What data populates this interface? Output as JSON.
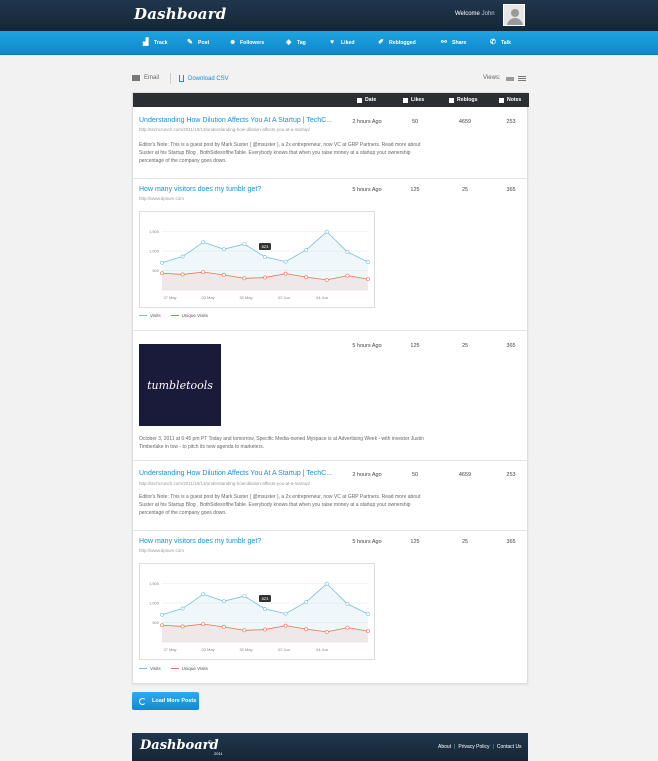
{
  "header": {
    "logo": "Dashboard",
    "welcome_prefix": "Welcome",
    "user_name": "John"
  },
  "nav": [
    {
      "label": "Track",
      "icon": "chart-icon"
    },
    {
      "label": "Post",
      "icon": "pen-icon"
    },
    {
      "label": "Followers",
      "icon": "people-icon"
    },
    {
      "label": "Tag",
      "icon": "tag-icon"
    },
    {
      "label": "Liked",
      "icon": "heart-icon"
    },
    {
      "label": "Reblogged",
      "icon": "pencil-icon"
    },
    {
      "label": "Share",
      "icon": "share-icon"
    },
    {
      "label": "Talk",
      "icon": "talk-icon"
    }
  ],
  "toolbar": {
    "email": "Email",
    "download": "Download CSV",
    "views": "Views:"
  },
  "table": {
    "columns": [
      "Date",
      "Likes",
      "Reblogs",
      "Notes"
    ]
  },
  "posts": [
    {
      "title": "Understanding How Dilution Affects You At A Startup | TechC...",
      "url": "http://techcrunch.com/2011/10/13/understanding-how-dilution-affects-you-at-a-startup/",
      "excerpt": "Editor's Note: This is a guest post by Mark Suster ( @msuster ), a 2x entrepreneur, now VC at GRP Partners. Read more about Suster at his Startup Blog , BothSidesoftheTable. Everybody knows that when you raise money at a startup your ownership percentage of the company goes down.",
      "date": "2 hours Ago",
      "likes": "50",
      "reblogs": "4659",
      "notes": "253"
    },
    {
      "title": "How many visitors does my tumblr get?",
      "url": "http://www.tipsum.com",
      "date": "5 hours Ago",
      "likes": "125",
      "reblogs": "25",
      "notes": "365",
      "legend": [
        "Visits",
        "Unique Visits"
      ]
    },
    {
      "image_text": "tumbletools",
      "excerpt": "October 3, 2011 at 6:45 pm PT Today and tomorrow, Specific Media-owned Myspace is at Advertising Week - with investor Justin Timberlake in tow - to pitch its new agenda to marketers.",
      "date": "5 hours Ago",
      "likes": "125",
      "reblogs": "25",
      "notes": "365"
    },
    {
      "title": "Understanding How Dilution Affects You At A Startup | TechC...",
      "url": "http://techcrunch.com/2011/10/13/understanding-how-dilution-affects-you-at-a-startup/",
      "excerpt": "Editor's Note: This is a guest post by Mark Suster ( @msuster ), a 2x entrepreneur, now VC at GRP Partners. Read more about Suster at his Startup Blog , BothSidesoftheTable. Everybody knows that when you raise money at a startup your ownership percentage of the company goes down.",
      "date": "2 hours Ago",
      "likes": "50",
      "reblogs": "4659",
      "notes": "253"
    },
    {
      "title": "How many visitors does my tumblr get?",
      "url": "http://www.tipsum.com",
      "date": "5 hours Ago",
      "likes": "125",
      "reblogs": "25",
      "notes": "365",
      "legend": [
        "Visits",
        "Unique Visits"
      ]
    }
  ],
  "chart_data": {
    "type": "line",
    "y_ticks": [
      "1,500",
      "1,000",
      "500"
    ],
    "x_ticks": [
      "27 May",
      "03 May",
      "30 May",
      "02 Jun",
      "04 Jun"
    ],
    "tooltip": "823",
    "ylim": [
      0,
      1800
    ],
    "series": [
      {
        "name": "Visits",
        "color": "#7bbfd6",
        "values": [
          700,
          860,
          1230,
          1050,
          1180,
          850,
          730,
          1030,
          1500,
          980,
          720
        ]
      },
      {
        "name": "Unique Visits",
        "color": "#e8714b",
        "values": [
          430,
          400,
          460,
          390,
          300,
          320,
          420,
          330,
          260,
          370,
          280
        ]
      }
    ]
  },
  "load_more": "Load More Posts",
  "footer": {
    "logo": "Dashboard",
    "copyright": "©",
    "year": "2011",
    "links": [
      "About",
      "Privacy Policy",
      "Contact Us"
    ]
  }
}
